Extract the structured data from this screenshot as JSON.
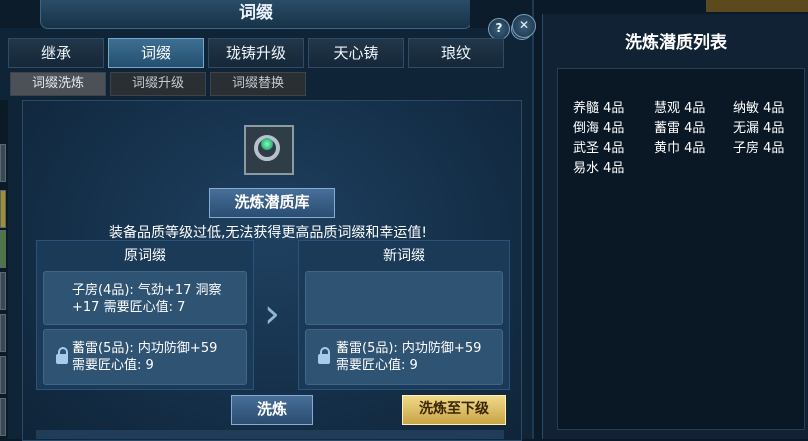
{
  "window": {
    "title": "词缀",
    "help_label": "?",
    "close_label": "✕"
  },
  "tabs": [
    {
      "label": "继承"
    },
    {
      "label": "词缀"
    },
    {
      "label": "珑铸升级"
    },
    {
      "label": "天心铸"
    },
    {
      "label": "琅纹"
    }
  ],
  "subtabs": [
    {
      "label": "词缀洗炼"
    },
    {
      "label": "词缀升级"
    },
    {
      "label": "词缀替换"
    }
  ],
  "content": {
    "library_button": "洗炼潜质库",
    "warning": "装备品质等级过低,无法获得更高品质词缀和幸运值!",
    "original": {
      "title": "原词缀",
      "affix1_line1": "子房(4品): 气劲+17 洞察",
      "affix1_line2": "+17  需要匠心值: 7",
      "affix2_line1": "蓄雷(5品): 内功防御+59",
      "affix2_line2": "需要匠心值:  9"
    },
    "new": {
      "title": "新词缀",
      "affix2_line1": "蓄雷(5品): 内功防御+59",
      "affix2_line2": "需要匠心值:  9"
    },
    "arrow": "›",
    "wash_button": "洗炼",
    "wash_next_button": "洗炼至下级"
  },
  "right_panel": {
    "title": "洗炼潜质列表",
    "close_label": "✕",
    "items": [
      "养髓 4品",
      "慧观 4品",
      "纳敏 4品",
      "倒海 4品",
      "蓄雷 4品",
      "无漏 4品",
      "武圣 4品",
      "黄巾 4品",
      "子房 4品",
      "易水 4品"
    ]
  }
}
